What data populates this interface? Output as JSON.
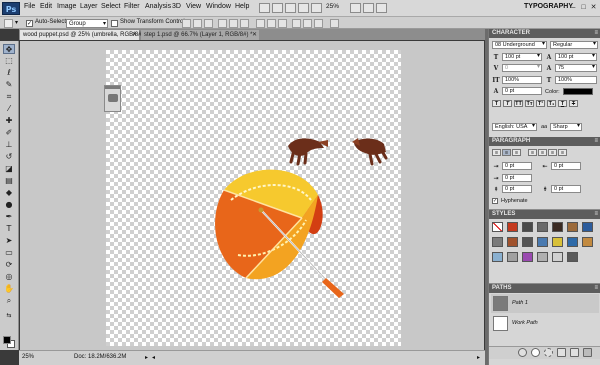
{
  "menubar": {
    "logo": "Ps",
    "items": [
      "File",
      "Edit",
      "Image",
      "Layer",
      "Select",
      "Filter",
      "Analysis",
      "3D",
      "View",
      "Window",
      "Help"
    ],
    "zoom": "25%",
    "workspace": "TYPOGRAPHY",
    "window_controls": [
      "–",
      "□",
      "✕"
    ]
  },
  "options": {
    "auto_select_label": "Auto-Select:",
    "auto_select_checked": true,
    "auto_select_target": "Group",
    "show_transform_label": "Show Transform Controls",
    "show_transform_checked": false
  },
  "tabs": [
    {
      "label": "wood puppet.psd @ 25% (umbrella, RGB/8#) *",
      "active": true
    },
    {
      "label": "step 1.psd @ 66.7% (Layer 1, RGB/8#) *",
      "active": false
    }
  ],
  "status": {
    "zoom": "25%",
    "doc": "Doc: 18.2M/636.2M"
  },
  "character": {
    "title": "CHARACTER",
    "font_family": "08 Underground",
    "font_style": "Regular",
    "size": "100 pt",
    "leading": "100 pt",
    "kerning": "0",
    "tracking": "75",
    "v_scale": "100%",
    "h_scale": "100%",
    "baseline": "0 pt",
    "color_label": "Color:",
    "color": "#000000",
    "style_buttons": [
      "T",
      "T",
      "TT",
      "Tт",
      "T¹",
      "T₁",
      "T",
      "T"
    ],
    "language": "English: USA",
    "aa_label": "aa",
    "antialias": "Sharp"
  },
  "paragraph": {
    "title": "PARAGRAPH",
    "indent_left": "0 pt",
    "indent_right": "0 pt",
    "first_line": "0 pt",
    "space_before": "0 pt",
    "space_after": "0 pt",
    "hyphenate_label": "Hyphenate",
    "hyphenate_checked": true
  },
  "styles": {
    "title": "STYLES",
    "swatches": [
      "#ffffff",
      "#c43a1f",
      "#4a4a4a",
      "#6a6a6a",
      "#3a2a22",
      "#9c6a3a",
      "#2c5c9c",
      "#7a7a7a",
      "#a0522d",
      "#555555",
      "#4a7ab0",
      "#d8c038",
      "#2e6aa8",
      "#c28a40",
      "#8ab0d0",
      "#a0a0a0",
      "#9a4ab0",
      "#b0b0b0",
      "#d0d0d0",
      "#5a5a5a"
    ]
  },
  "paths": {
    "title": "PATHS",
    "items": [
      {
        "name": "Path 1",
        "thumb": "#7a7a7a"
      },
      {
        "name": "Work Path",
        "thumb": "#ffffff"
      }
    ]
  },
  "colors": {
    "umbrella_yellow": "#f6c92e",
    "umbrella_orange": "#e8661a",
    "umbrella_red": "#d33e12",
    "hand_brown": "#6b2e1a"
  }
}
